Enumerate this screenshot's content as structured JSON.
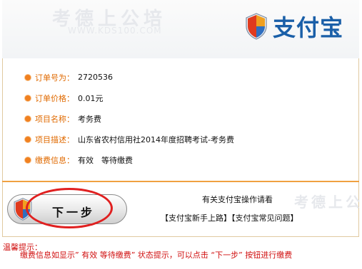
{
  "brand": {
    "logo_text": "支付宝",
    "watermark_text": "考德上公培",
    "watermark_url": "WWW.KDS100.COM"
  },
  "order": {
    "rows": [
      {
        "label": "订单号为：",
        "value": "2720536"
      },
      {
        "label": "订单价格：",
        "value": "0.01元"
      },
      {
        "label": "项目名称：",
        "value": "考务费"
      },
      {
        "label": "项目描述：",
        "value": "山东省农村信用社2014年度招聘考试-考务费"
      },
      {
        "label": "缴费信息：",
        "value": "有效　等待缴费"
      }
    ]
  },
  "actions": {
    "next_label": "下一步"
  },
  "help": {
    "title": "有关支付宝操作请看",
    "link_newbie": "【支付宝新手上路】",
    "link_faq": "【支付宝常见问题】"
  },
  "tips": {
    "title": "温馨提示：",
    "text": "缴费信息如显示” 有效 等待缴费” 状态提示，可以点击 “下一步” 按钮进行缴费"
  },
  "colors": {
    "accent_orange": "#e06a00",
    "logo_blue": "#1a5fa8",
    "warning_red": "#d01010",
    "highlight_ellipse": "#e02020"
  }
}
